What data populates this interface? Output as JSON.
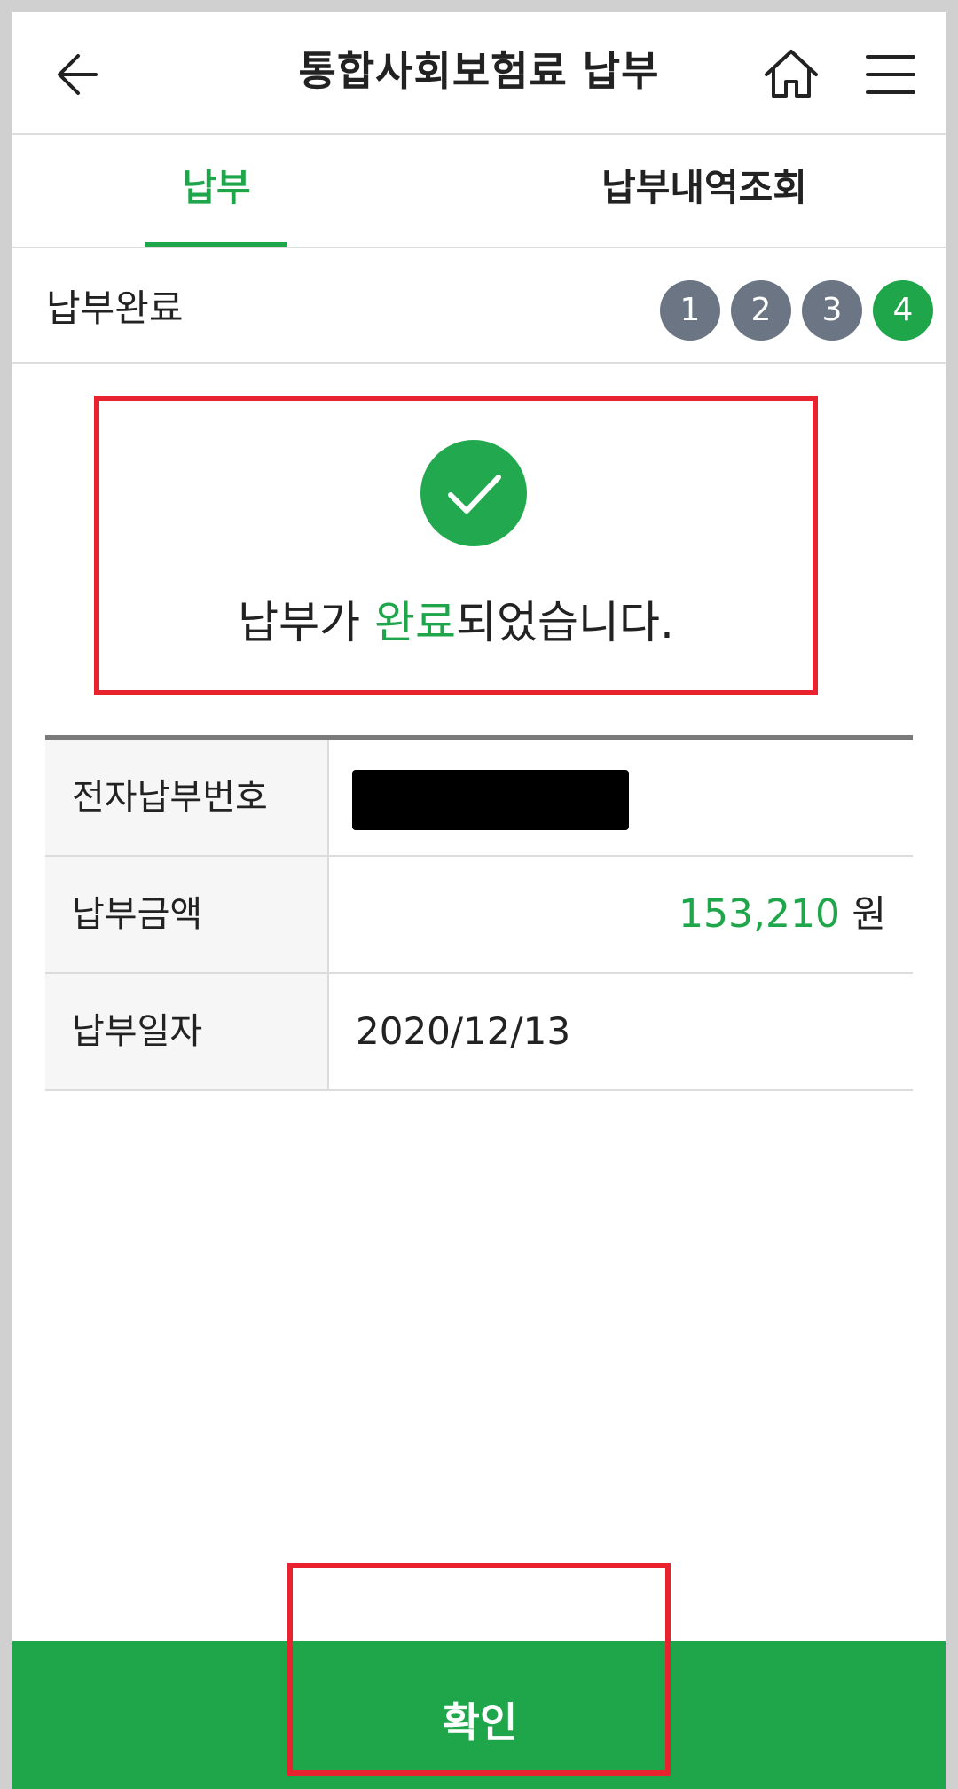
{
  "header": {
    "title": "통합사회보험료 납부",
    "back_icon": "arrow-left-icon",
    "home_icon": "home-icon",
    "menu_icon": "hamburger-menu-icon"
  },
  "tabs": [
    {
      "label": "납부",
      "active": true
    },
    {
      "label": "납부내역조회",
      "active": false
    }
  ],
  "progress": {
    "label": "납부완료",
    "steps": [
      "1",
      "2",
      "3",
      "4"
    ],
    "current_step": 4
  },
  "result": {
    "icon": "check-circle-icon",
    "message_prefix": "납부가 ",
    "message_highlight": "완료",
    "message_suffix": "되었습니다."
  },
  "details": {
    "rows": [
      {
        "label": "전자납부번호",
        "value": ""
      },
      {
        "label": "납부금액",
        "amount": "153,210",
        "unit": "원"
      },
      {
        "label": "납부일자",
        "value": "2020/12/13"
      }
    ]
  },
  "footer": {
    "confirm_label": "확인"
  },
  "colors": {
    "accent": "#1fa64a",
    "step_inactive": "#6b7584",
    "highlight_box": "#e8232f"
  }
}
